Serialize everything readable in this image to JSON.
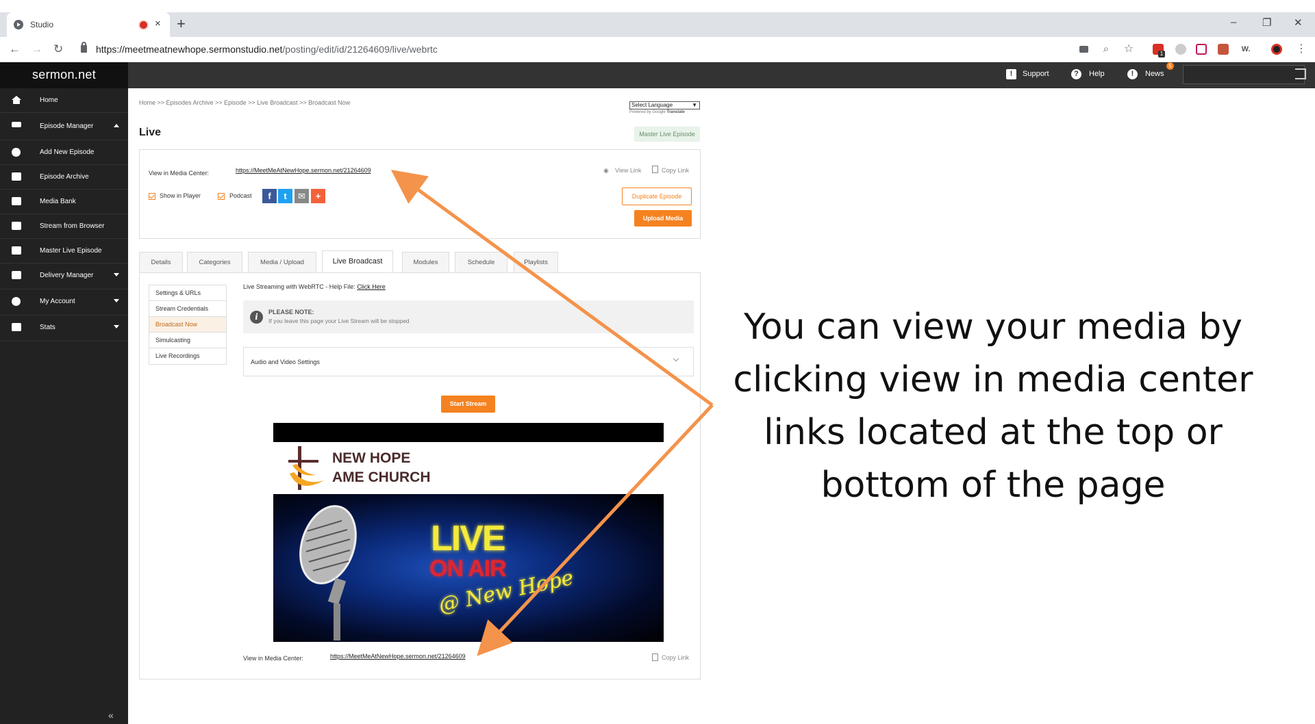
{
  "browser": {
    "tab_title": "Studio",
    "new_tab": "+",
    "tab_close": "×",
    "url_host": "https://meetmeatnewhope.sermonstudio.net",
    "url_path": "/posting/edit/id/21264609/live/webrtc",
    "window_minimize": "–",
    "window_restore": "❐",
    "window_close": "✕",
    "extension_badge": "1",
    "ext_w_label": "W."
  },
  "app": {
    "logo": "sermon.net",
    "header": {
      "support": "Support",
      "help": "Help",
      "news": "News",
      "news_count": "5"
    }
  },
  "sidebar": {
    "items": [
      {
        "label": "Home"
      },
      {
        "label": "Episode Manager"
      },
      {
        "label": "Add New Episode"
      },
      {
        "label": "Episode Archive"
      },
      {
        "label": "Media Bank"
      },
      {
        "label": "Stream from Browser"
      },
      {
        "label": "Master Live Episode"
      },
      {
        "label": "Delivery Manager"
      },
      {
        "label": "My Account"
      },
      {
        "label": "Stats"
      }
    ],
    "collapse": "«"
  },
  "content": {
    "breadcrumb": "Home >> Episodes Archive >> Episode >> Live Broadcast >> Broadcast Now",
    "language_select": "Select Language",
    "powered_by": "Powered by",
    "google": "Google",
    "translate": "Translate",
    "page_title": "Live",
    "master_live_button": "Master Live Episode",
    "view_in_media_center_label": "View in Media Center:",
    "media_center_url": "https://MeetMeAtNewHope.sermon.net/21264609",
    "view_link": "View Link",
    "copy_link": "Copy Link",
    "show_in_player": "Show in Player",
    "podcast": "Podcast",
    "duplicate_button": "Duplicate Episode",
    "upload_button": "Upload Media"
  },
  "tabs": [
    {
      "label": "Details"
    },
    {
      "label": "Categories"
    },
    {
      "label": "Media / Upload"
    },
    {
      "label": "Live Broadcast"
    },
    {
      "label": "Modules"
    },
    {
      "label": "Schedule"
    },
    {
      "label": "Playlists"
    }
  ],
  "live_panel": {
    "subnav": [
      {
        "label": "Settings & URLs"
      },
      {
        "label": "Stream Credentials"
      },
      {
        "label": "Broadcast Now"
      },
      {
        "label": "Simulcasting"
      },
      {
        "label": "Live Recordings"
      }
    ],
    "help_text": "Live Streaming with WebRTC - Help File:",
    "help_link": "Click Here",
    "note_title": "PLEASE NOTE:",
    "note_text": "If you leave this page your Live Stream will be stopped",
    "av_settings": "Audio and Video Settings",
    "start_button": "Start Stream",
    "video": {
      "church_line1": "NEW HOPE",
      "church_line2": "AME CHURCH",
      "live": "LIVE",
      "on_air": "ON AIR",
      "new_hope": "@ New Hope"
    },
    "bottom_view_label": "View in Media Center:",
    "bottom_url": "https://MeetMeAtNewHope.sermon.net/21264609",
    "bottom_copy_link": "Copy Link"
  },
  "annotation": {
    "lines": [
      "You can view your media by",
      "clicking view in media center",
      "links located at the top or",
      "bottom of the page"
    ]
  },
  "colors": {
    "accent": "#f58220",
    "sidebar_bg": "#222222",
    "header_bg": "#333333",
    "arrow": "#f4934b"
  }
}
